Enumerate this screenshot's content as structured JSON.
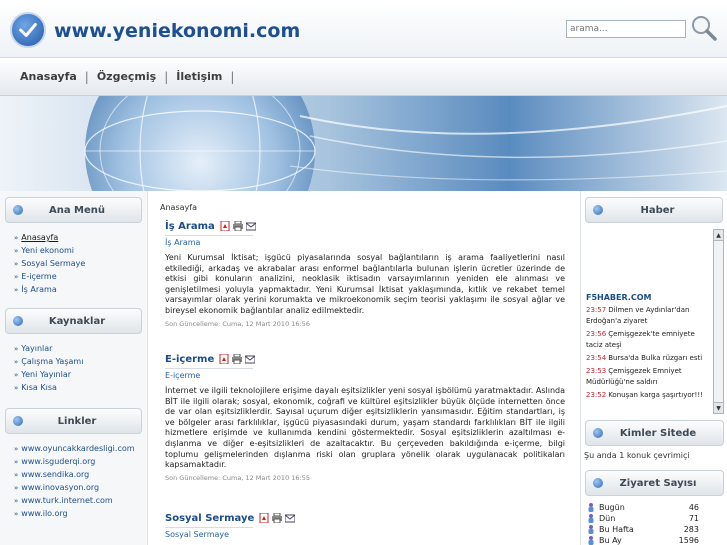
{
  "site": {
    "title": "www.yeniekonomi.com"
  },
  "search": {
    "placeholder": "arama..."
  },
  "nav": {
    "items": [
      "Anasayfa",
      "Özgeçmiş",
      "İletişim"
    ],
    "separator": "|"
  },
  "left": {
    "main_menu": {
      "title": "Ana Menü",
      "items": [
        "Anasayfa",
        "Yeni ekonomi",
        "Sosyal Sermaye",
        "E-içerme",
        "İş Arama"
      ]
    },
    "sources": {
      "title": "Kaynaklar",
      "items": [
        "Yayınlar",
        "Çalışma Yaşamı",
        "Yeni Yayınlar",
        "Kısa Kısa"
      ]
    },
    "links": {
      "title": "Linkler",
      "items": [
        "www.oyuncakkardesligi.com",
        "www.isguderqi.org",
        "www.sendika.org",
        "www.inovasyon.org",
        "www.turk.internet.com",
        "www.ilo.org"
      ]
    }
  },
  "center": {
    "breadcrumb": "Anasayfa",
    "articles": [
      {
        "title": "İş Arama",
        "subtitle": "İş Arama",
        "body": "Yeni Kurumsal İktisat; işgücü piyasalarında sosyal bağlantıların iş arama faaliyetlerini nasıl etkilediği, arkadaş ve akrabalar arası enformel bağlantılarla bulunan işlerin ücretler üzerinde de etkisi gibi konuların analizini, neoklasik iktisadın varsayımlarının yeniden ele alınması ve genişletilmesi yoluyla yapmaktadır. Yeni Kurumsal İktisat yaklaşımında, kıtlık ve rekabet temel varsayımlar olarak yerini korumakta ve mikroekonomik seçim teorisi yaklaşımı ile sosyal ağlar ve bireysel ekonomik bağlantılar analiz edilmektedir.",
        "date": "Son Güncelleme: Cuma, 12 Mart 2010 16:56"
      },
      {
        "title": "E-içerme",
        "subtitle": "E-içerme",
        "body": "İnternet ve ilgili teknolojilere erişime dayalı eşitsizlikler yeni sosyal işbölümü yaratmaktadır. Aslında BİT ile ilgili olarak; sosyal, ekonomik, coğrafi ve kültürel eşitsizlikler büyük ölçüde internetten önce de var olan eşitsizliklerdir. Sayısal uçurum diğer eşitsizliklerin yansımasıdır. Eğitim standartları, iş ve bölgeler arası farklılıklar, işgücü piyasasındaki durum, yaşam standardı farklılıkları BİT ile ilgili hizmetlere erişimde ve kullanımda kendini göstermektedir. Sosyal eşitsizliklerin azaltılması e-dışlanma ve diğer e-eşitsizlikleri de azaltacaktır. Bu çerçeveden bakıldığında e-içerme, bilgi toplumu gelişmelerinden dışlanma riski olan gruplara yönelik olarak uygulanacak politikaları kapsamaktadır.",
        "date": "Son Güncelleme: Cuma, 12 Mart 2010 16:55"
      },
      {
        "title": "Sosyal Sermaye",
        "subtitle": "Sosyal Sermaye",
        "body": "",
        "date": ""
      }
    ]
  },
  "right": {
    "news": {
      "title": "Haber",
      "source": "F5HABER.COM",
      "items": [
        {
          "time": "23:57",
          "text": "Dilmen ve Aydınlar'dan Erdoğan'a ziyaret"
        },
        {
          "time": "23:56",
          "text": "Çemişgezek'te emniyete taciz ateşi"
        },
        {
          "time": "23:54",
          "text": "Bursa'da Bulka rüzgarı esti"
        },
        {
          "time": "23:53",
          "text": "Çemişgezek Emniyet Müdürlüğü'ne saldırı"
        },
        {
          "time": "23:52",
          "text": "Konuşan karga şaşırtıyor!!!"
        }
      ]
    },
    "online": {
      "title": "Kimler Sitede",
      "text": "Şu anda 1 konuk çevrimiçi"
    },
    "stats": {
      "title": "Ziyaret Sayısı",
      "rows": [
        {
          "label": "Bugün",
          "value": "46"
        },
        {
          "label": "Dün",
          "value": "71"
        },
        {
          "label": "Bu Hafta",
          "value": "283"
        },
        {
          "label": "Bu Ay",
          "value": "1596"
        }
      ]
    }
  },
  "colors": {
    "link": "#1f4f8a",
    "title": "#1b4b8a",
    "news_time": "#c4262e"
  }
}
